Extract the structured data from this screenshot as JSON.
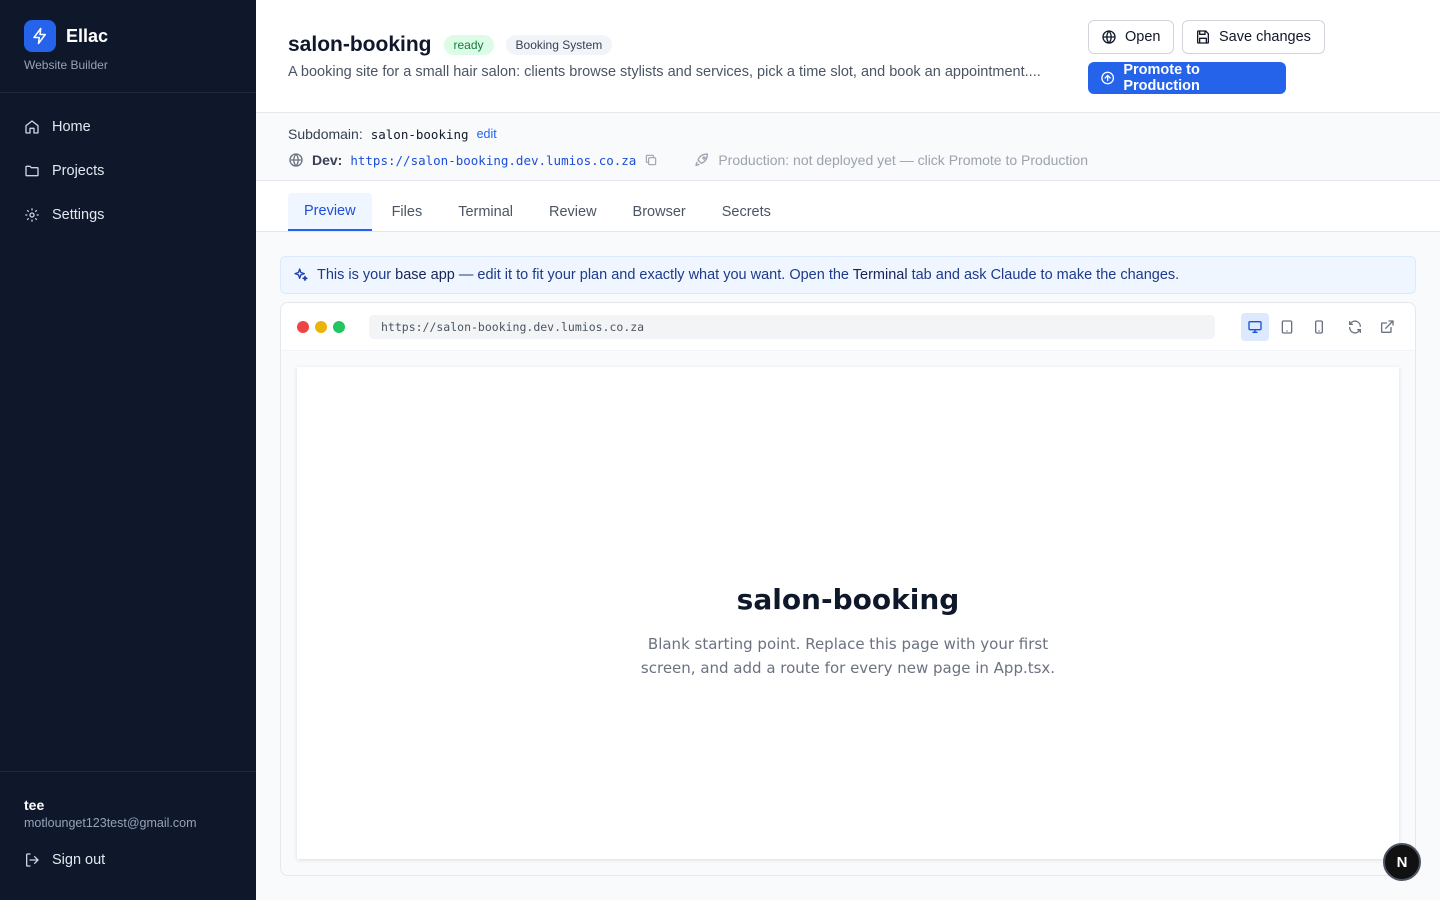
{
  "sidebar": {
    "brand_name": "Ellac",
    "brand_sub": "Website Builder",
    "items": [
      {
        "label": "Home",
        "icon": "home-icon"
      },
      {
        "label": "Projects",
        "icon": "folder-icon"
      },
      {
        "label": "Settings",
        "icon": "gear-icon"
      }
    ],
    "user_name": "tee",
    "user_email": "motlounget123test@gmail.com",
    "signout_label": "Sign out"
  },
  "header": {
    "title": "salon-booking",
    "status_badge": "ready",
    "type_badge": "Booking System",
    "description": "A booking site for a small hair salon: clients browse stylists and services, pick a time slot, and book an appointment....",
    "open_label": "Open",
    "save_label": "Save changes",
    "promote_label": "Promote to Production"
  },
  "meta": {
    "subdomain_label": "Subdomain:",
    "subdomain_value": "salon-booking",
    "edit_label": "edit",
    "dev_label": "Dev:",
    "dev_url": "https://salon-booking.dev.lumios.co.za",
    "production_note": "Production: not deployed yet — click Promote to Production"
  },
  "tabs": [
    "Preview",
    "Files",
    "Terminal",
    "Review",
    "Browser",
    "Secrets"
  ],
  "active_tab": "Preview",
  "banner": {
    "part1": "This is your ",
    "base_app": "base app",
    "part2": " — edit it to fit your plan and exactly what you want. Open the ",
    "terminal": "Terminal",
    "part3": " tab and ask Claude to make the changes."
  },
  "preview": {
    "url": "https://salon-booking.dev.lumios.co.za",
    "title": "salon-booking",
    "text": "Blank starting point. Replace this page with your first screen, and add a route for every new page in App.tsx."
  },
  "n_badge": "N",
  "colors": {
    "sidebar_bg": "#0f172a",
    "accent": "#2563eb",
    "ready_green": "#15803d",
    "dot_red": "#ef4444",
    "dot_yellow": "#eab308",
    "dot_green": "#22c55e"
  }
}
